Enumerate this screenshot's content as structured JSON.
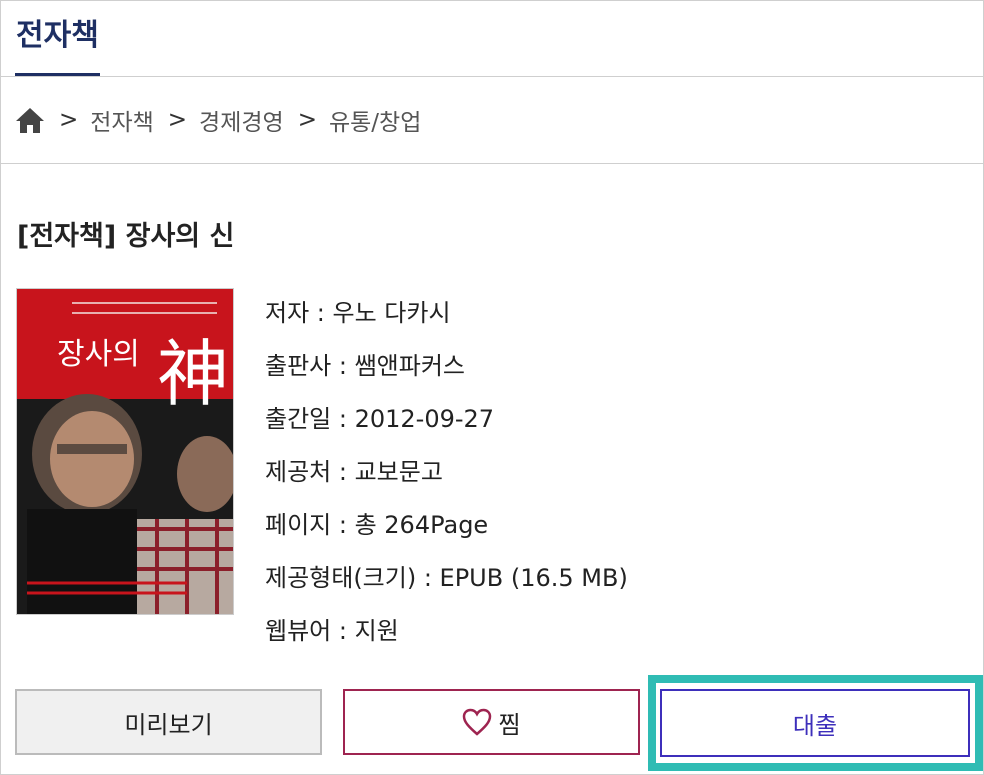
{
  "header": {
    "tab_label": "전자책"
  },
  "breadcrumb": {
    "separator": ">",
    "items": [
      "전자책",
      "경제경영",
      "유통/창업"
    ]
  },
  "book": {
    "title": "[전자책] 장사의 신",
    "cover": {
      "title_text": "장사의",
      "title_glyph": "神"
    },
    "info": [
      {
        "label": "저자 : 우노 다카시"
      },
      {
        "label": "출판사 : 쌤앤파커스"
      },
      {
        "label": "출간일 : 2012-09-27"
      },
      {
        "label": "제공처 : 교보문고"
      },
      {
        "label": "페이지 : 총 264Page"
      },
      {
        "label": "제공형태(크기) : EPUB (16.5 MB)"
      },
      {
        "label": "웹뷰어 : 지원"
      }
    ]
  },
  "buttons": {
    "preview": "미리보기",
    "zzim": "찜",
    "loan": "대출"
  },
  "colors": {
    "header_accent": "#1e2f63",
    "zzim_border": "#9e2450",
    "loan_border": "#3d2fbb",
    "loan_highlight": "#2fbcb4"
  }
}
